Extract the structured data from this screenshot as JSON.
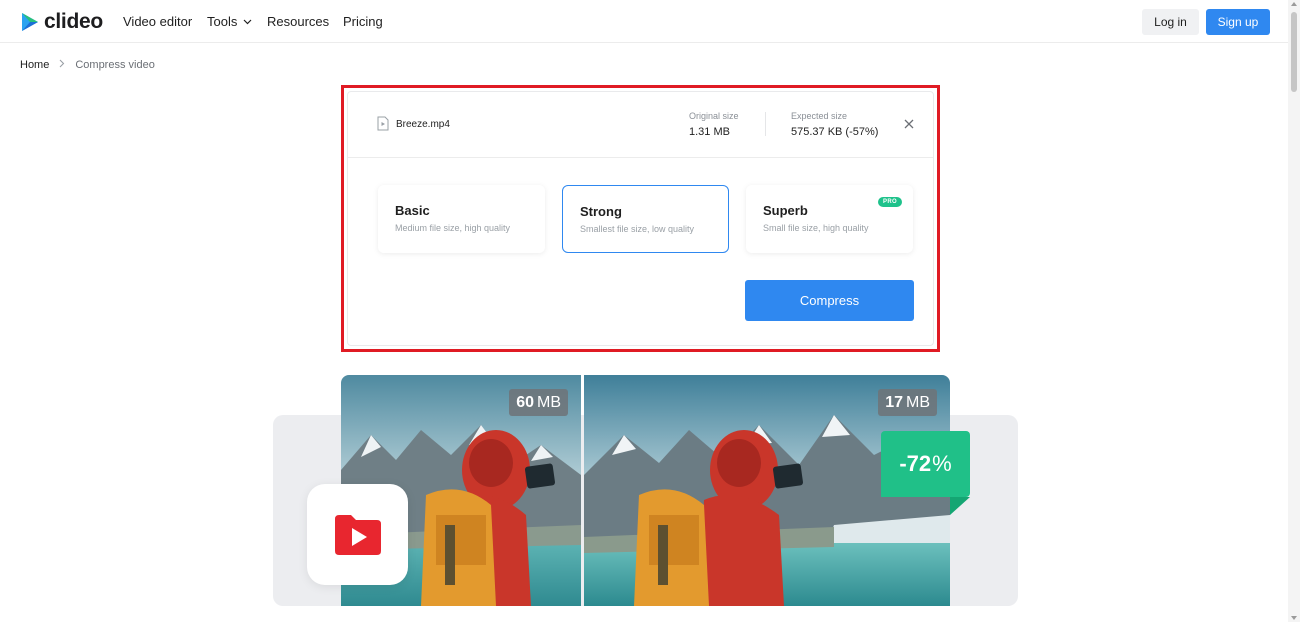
{
  "header": {
    "logo_text": "clideo",
    "nav": {
      "video_editor": "Video editor",
      "tools": "Tools",
      "resources": "Resources",
      "pricing": "Pricing"
    },
    "login_label": "Log in",
    "signup_label": "Sign up"
  },
  "breadcrumb": {
    "home": "Home",
    "current": "Compress video"
  },
  "file": {
    "name": "Breeze.mp4",
    "original_label": "Original size",
    "original_value": "1.31 MB",
    "expected_label": "Expected size",
    "expected_value": "575.37 KB (-57%)"
  },
  "options": [
    {
      "title": "Basic",
      "desc": "Medium file size, high quality",
      "selected": false
    },
    {
      "title": "Strong",
      "desc": "Smallest file size, low quality",
      "selected": true
    },
    {
      "title": "Superb",
      "desc": "Small file size, high quality",
      "selected": false,
      "badge": "PRO"
    }
  ],
  "compress_label": "Compress",
  "illustration": {
    "before_size_num": "60",
    "before_size_unit": "MB",
    "after_size_num": "17",
    "after_size_unit": "MB",
    "reduction_num": "-72",
    "reduction_unit": "%"
  },
  "colors": {
    "accent": "#2f88f0",
    "highlight": "#e01b24",
    "success": "#20c088",
    "brand_red": "#e8262f"
  }
}
